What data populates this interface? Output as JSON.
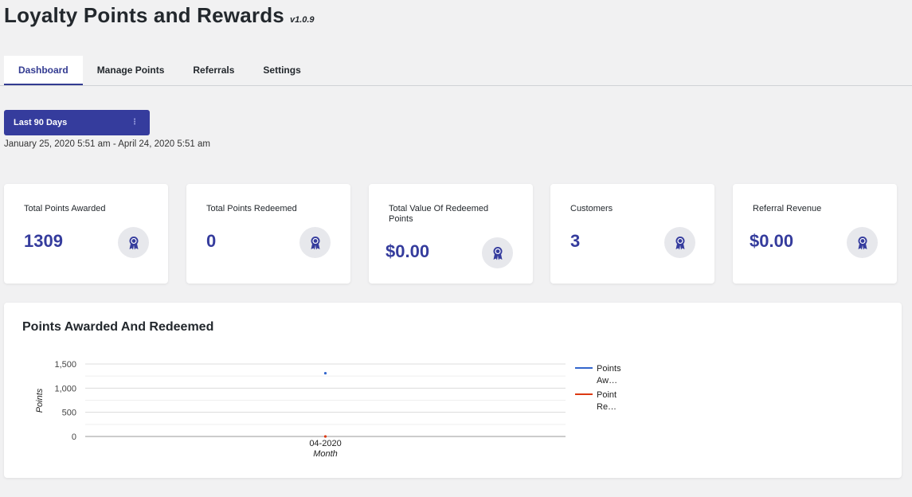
{
  "header": {
    "title": "Loyalty Points and Rewards",
    "version": "v1.0.9"
  },
  "tabs": [
    {
      "label": "Dashboard",
      "active": true
    },
    {
      "label": "Manage Points",
      "active": false
    },
    {
      "label": "Referrals",
      "active": false
    },
    {
      "label": "Settings",
      "active": false
    }
  ],
  "filter": {
    "selected": "Last 90 Days",
    "date_range": "January 25, 2020 5:51 am - April 24, 2020 5:51 am"
  },
  "stats": [
    {
      "label": "Total Points Awarded",
      "value": "1309",
      "icon": "award-ribbon-icon"
    },
    {
      "label": "Total Points Redeemed",
      "value": "0",
      "icon": "award-ribbon-icon"
    },
    {
      "label": "Total Value Of Redeemed Points",
      "value": "$0.00",
      "icon": "award-ribbon-icon"
    },
    {
      "label": "Customers",
      "value": "3",
      "icon": "award-ribbon-icon"
    },
    {
      "label": "Referral Revenue",
      "value": "$0.00",
      "icon": "award-ribbon-icon"
    }
  ],
  "colors": {
    "accent": "#353c9d",
    "series_awarded": "#3366cc",
    "series_redeemed": "#dc3912"
  },
  "chart_panel": {
    "title": "Points Awarded And Redeemed"
  },
  "chart_data": {
    "type": "line",
    "x": [
      "04-2020"
    ],
    "xlabel": "Month",
    "ylabel": "Points",
    "ylim": [
      0,
      1500
    ],
    "yticks": [
      "0",
      "500",
      "1,000",
      "1,500"
    ],
    "grid": true,
    "legend_position": "right",
    "series": [
      {
        "name": "Points Aw…",
        "values": [
          1309
        ]
      },
      {
        "name": "Point Re…",
        "values": [
          0
        ]
      }
    ]
  }
}
